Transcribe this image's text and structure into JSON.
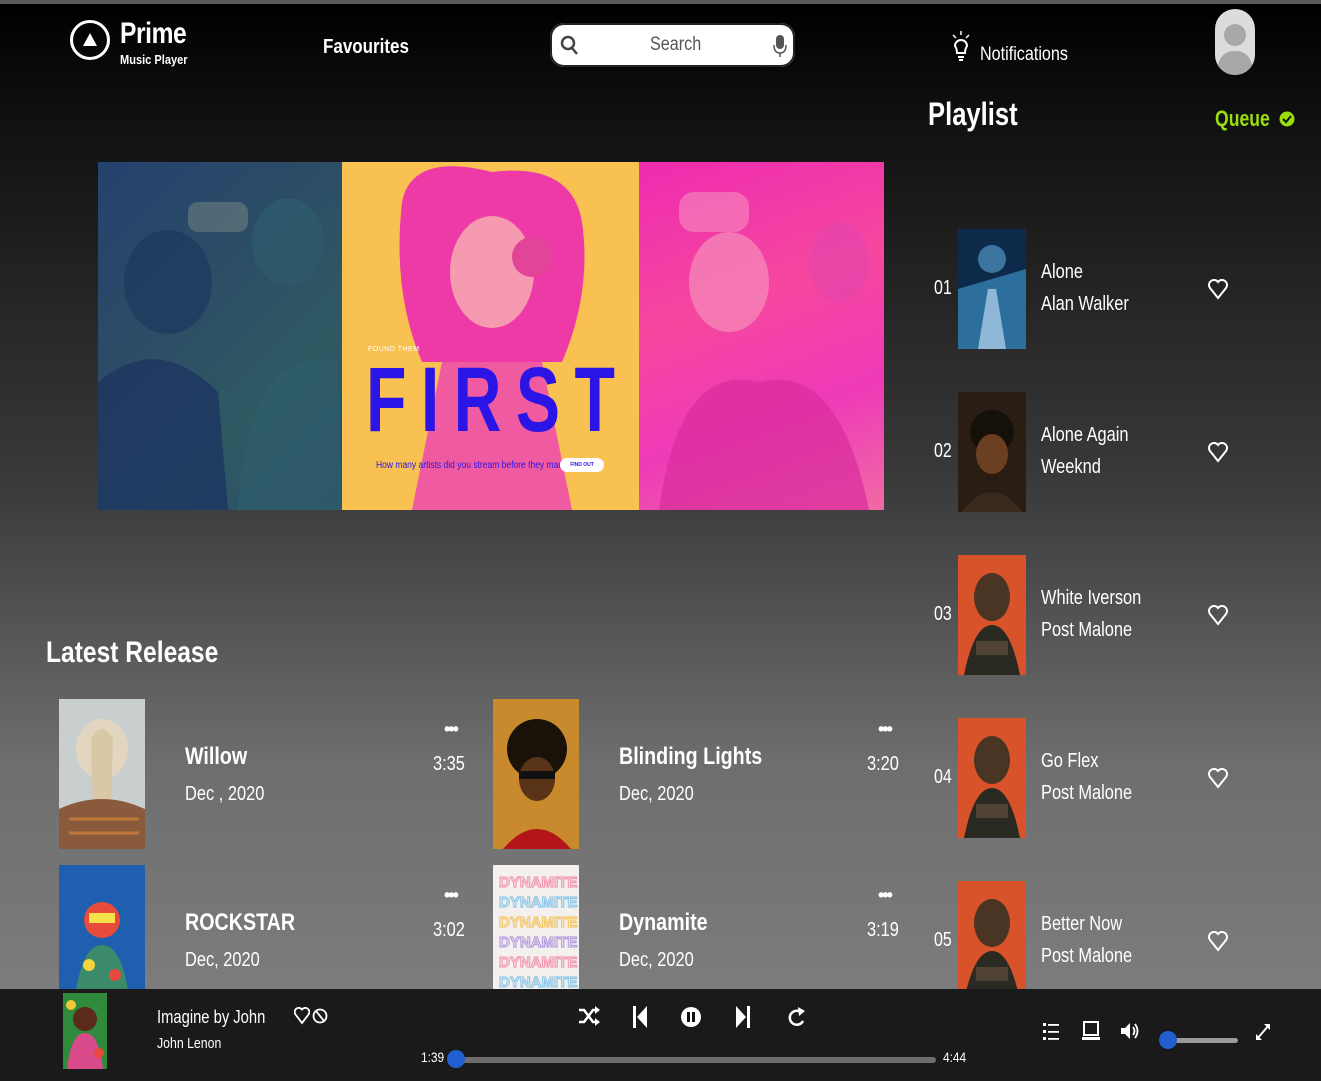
{
  "header": {
    "logo_title": "Prime",
    "logo_subtitle": "Music Player",
    "favourites": "Favourites",
    "search_placeholder": "Search",
    "notifications": "Notifications"
  },
  "banner": {
    "kicker": "FOUND THEM",
    "title": "FIRST",
    "subtitle": "How many artists did you stream before they made it big?",
    "button": "FIND OUT"
  },
  "latest": {
    "title": "Latest Release",
    "items": [
      {
        "name": "Willow",
        "date": "Dec , 2020",
        "duration": "3:35",
        "more": "•••"
      },
      {
        "name": "Blinding Lights",
        "date": "Dec, 2020",
        "duration": "3:20",
        "more": "•••"
      },
      {
        "name": "ROCKSTAR",
        "date": "Dec, 2020",
        "duration": "3:02",
        "more": "•••"
      },
      {
        "name": "Dynamite",
        "date": "Dec, 2020",
        "duration": "3:19",
        "more": "•••"
      }
    ]
  },
  "playlist": {
    "title": "Playlist",
    "queue": "Queue",
    "items": [
      {
        "num": "01",
        "title": "Alone",
        "artist": "Alan Walker"
      },
      {
        "num": "02",
        "title": "Alone Again",
        "artist": "Weeknd"
      },
      {
        "num": "03",
        "title": "White Iverson",
        "artist": "Post Malone"
      },
      {
        "num": "04",
        "title": "Go Flex",
        "artist": "Post Malone"
      },
      {
        "num": "05",
        "title": "Better Now",
        "artist": "Post Malone"
      }
    ]
  },
  "player": {
    "title": "Imagine by John",
    "artist": "John Lenon",
    "elapsed": "1:39",
    "total": "4:44",
    "progress_fraction": 0.0,
    "volume_fraction": 0.0
  },
  "colors": {
    "accent": "#9ade0c",
    "slider": "#1f5fcf",
    "banner_title": "#2a15e6"
  }
}
